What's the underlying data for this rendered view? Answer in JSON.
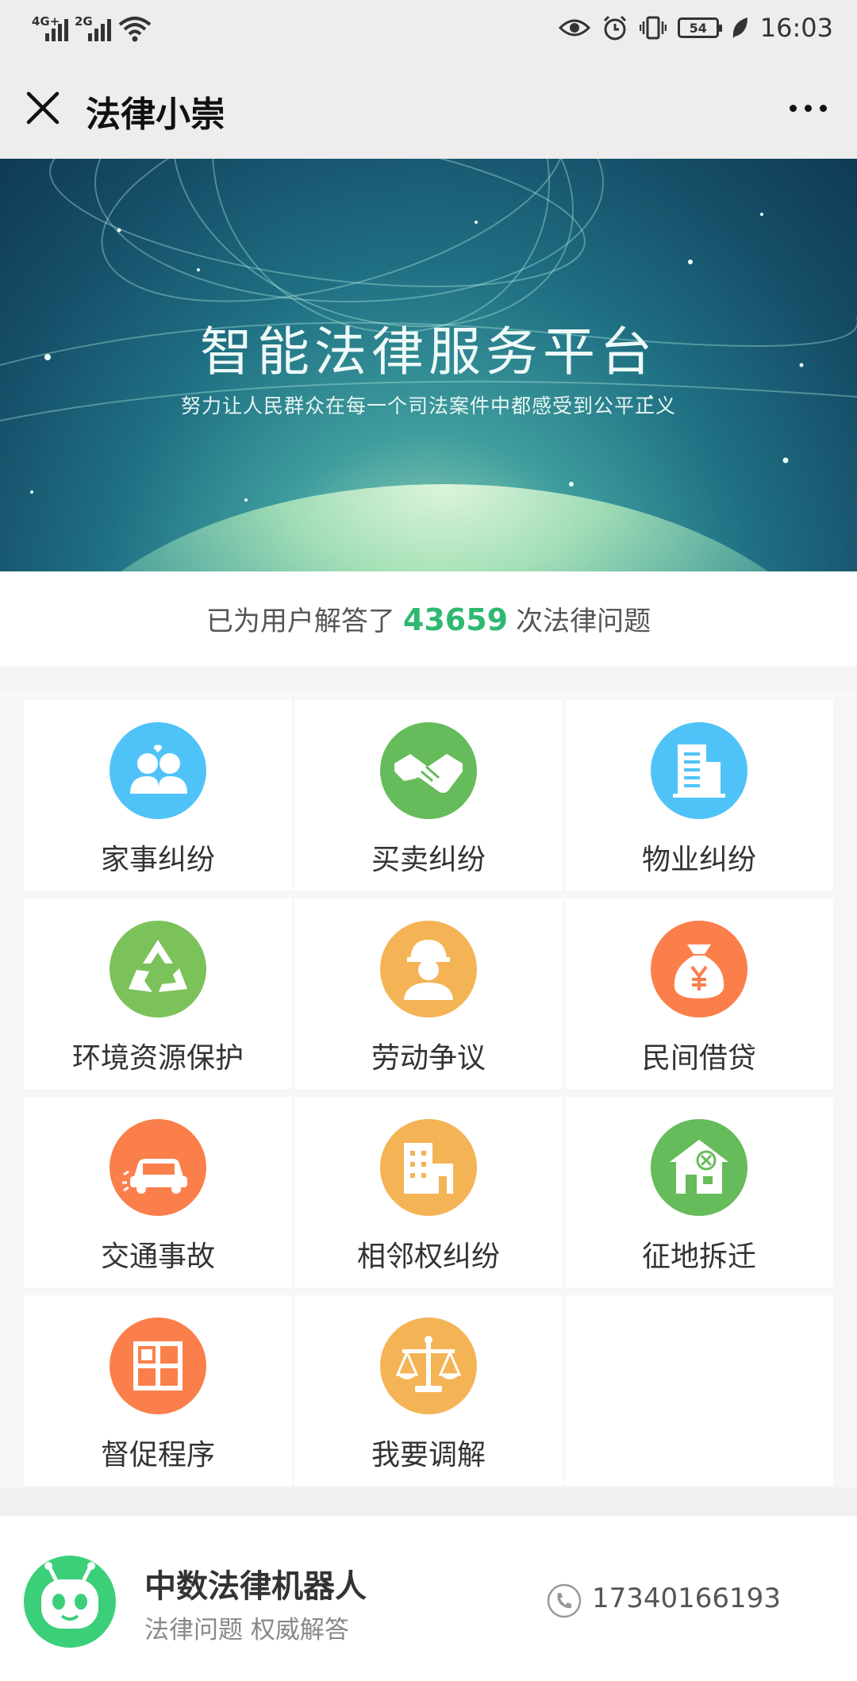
{
  "status_bar": {
    "sim1_network": "4G+",
    "sim2_network": "2G",
    "battery": "54",
    "time": "16:03"
  },
  "nav": {
    "title": "法律小崇"
  },
  "banner": {
    "title": "智能法律服务平台",
    "subtitle": "努力让人民群众在每一个司法案件中都感受到公平正义"
  },
  "stats": {
    "prefix": "已为用户解答了",
    "count": "43659",
    "suffix": "次法律问题"
  },
  "categories": [
    {
      "label": "家事纠纷",
      "icon": "family-dispute-icon",
      "color": "#4fc3f7"
    },
    {
      "label": "买卖纠纷",
      "icon": "handshake-icon",
      "color": "#66bb5a"
    },
    {
      "label": "物业纠纷",
      "icon": "building-icon",
      "color": "#4fc3f7"
    },
    {
      "label": "环境资源保护",
      "icon": "recycle-icon",
      "color": "#7cc25a"
    },
    {
      "label": "劳动争议",
      "icon": "worker-icon",
      "color": "#f4b455"
    },
    {
      "label": "民间借贷",
      "icon": "money-bag-icon",
      "color": "#fb7f4b"
    },
    {
      "label": "交通事故",
      "icon": "car-accident-icon",
      "color": "#fb7f4b"
    },
    {
      "label": "相邻权纠纷",
      "icon": "neighbor-building-icon",
      "color": "#f4b455"
    },
    {
      "label": "征地拆迁",
      "icon": "demolition-house-icon",
      "color": "#66bb5a"
    },
    {
      "label": "督促程序",
      "icon": "grid-window-icon",
      "color": "#fb7f4b"
    },
    {
      "label": "我要调解",
      "icon": "scales-icon",
      "color": "#f4b455"
    }
  ],
  "footer": {
    "name": "中数法律机器人",
    "tagline": "法律问题 权威解答",
    "phone": "17340166193"
  }
}
